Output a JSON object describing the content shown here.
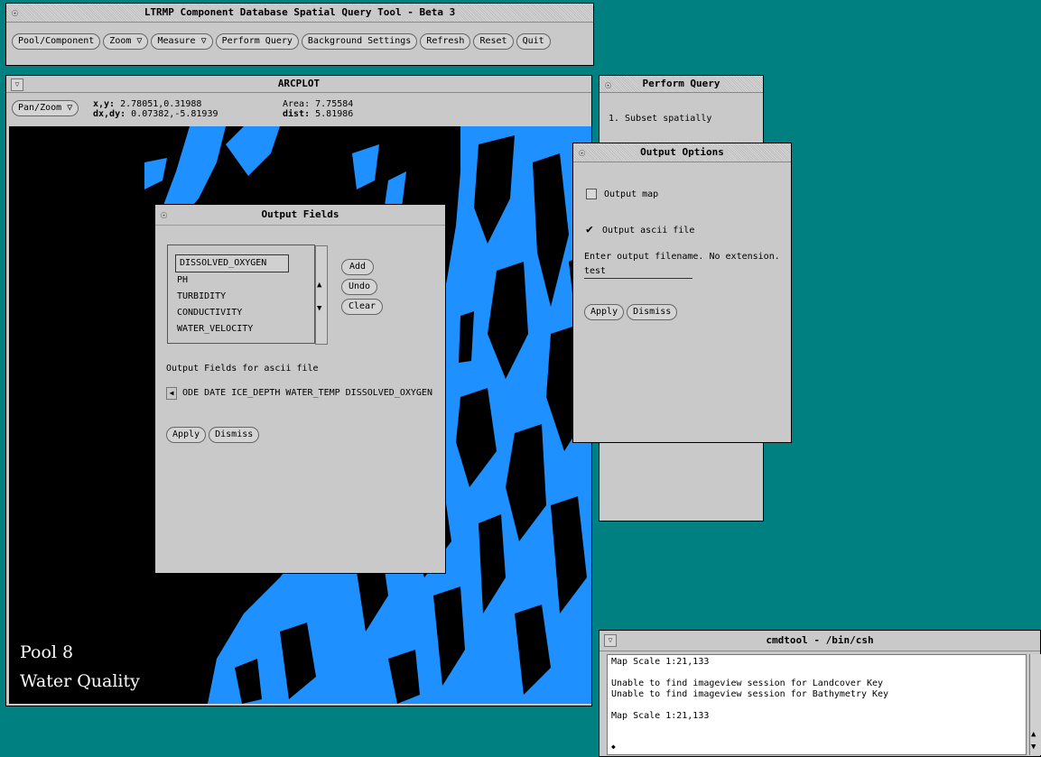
{
  "main_window": {
    "title": "LTRMP Component Database Spatial Query Tool - Beta 3",
    "buttons": [
      {
        "label": "Pool/Component",
        "menu": false
      },
      {
        "label": "Zoom",
        "menu": true
      },
      {
        "label": "Measure",
        "menu": true
      },
      {
        "label": "Perform Query",
        "menu": false
      },
      {
        "label": "Background Settings",
        "menu": false
      },
      {
        "label": "Refresh",
        "menu": false
      },
      {
        "label": "Reset",
        "menu": false
      },
      {
        "label": "Quit",
        "menu": false
      }
    ]
  },
  "arcplot": {
    "title": "ARCPLOT",
    "panzoom_label": "Pan/Zoom",
    "xy_label": "x,y:",
    "xy_value": "2.78051,0.31988",
    "dxdy_label": "dx,dy:",
    "dxdy_value": "0.07382,-5.81939",
    "area_label": "Area:",
    "area_value": "7.75584",
    "dist_label": "dist:",
    "dist_value": "5.81986",
    "map_label_line1": "Pool 8",
    "map_label_line2": "Water Quality"
  },
  "perform_query": {
    "title": "Perform Query",
    "step1": "1. Subset spatially"
  },
  "output_options": {
    "title": "Output Options",
    "output_map_label": "Output map",
    "output_map_checked": false,
    "output_ascii_label": "Output ascii file",
    "output_ascii_checked": true,
    "filename_prompt": "Enter output filename. No extension.",
    "filename_value": "test",
    "apply_label": "Apply",
    "dismiss_label": "Dismiss"
  },
  "output_fields": {
    "title": "Output Fields",
    "list_items": [
      "DISSOLVED_OXYGEN",
      "PH",
      "TURBIDITY",
      "CONDUCTIVITY",
      "WATER_VELOCITY"
    ],
    "selected_item": "DISSOLVED_OXYGEN",
    "add_label": "Add",
    "undo_label": "Undo",
    "clear_label": "Clear",
    "ascii_fields_label": "Output Fields for ascii file",
    "ascii_fields_value": "ODE DATE ICE_DEPTH WATER_TEMP DISSOLVED_OXYGEN",
    "apply_label": "Apply",
    "dismiss_label": "Dismiss"
  },
  "cmdtool": {
    "title": "cmdtool - /bin/csh",
    "lines": [
      "Map Scale 1:21,133",
      "",
      "Unable to find imageview session for Landcover Key",
      "Unable to find imageview session for Bathymetry Key",
      "",
      "Map Scale 1:21,133"
    ]
  },
  "colors": {
    "desktop": "#008080",
    "window": "#c9c9c9",
    "water": "#1e90ff",
    "land": "#000000"
  }
}
